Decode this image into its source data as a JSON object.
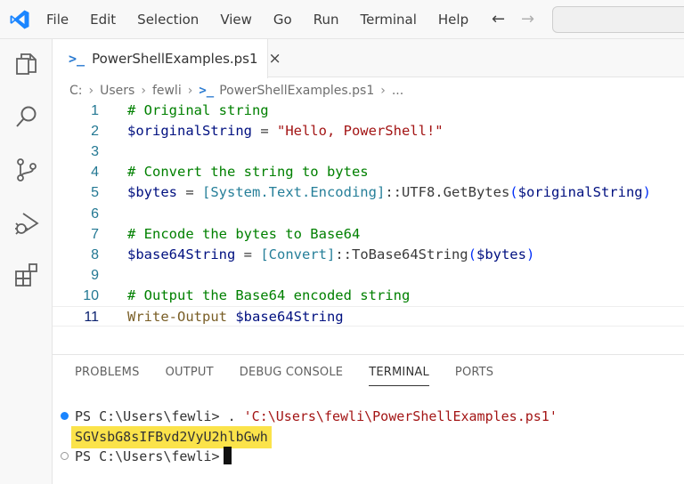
{
  "menu": {
    "items": [
      "File",
      "Edit",
      "Selection",
      "View",
      "Go",
      "Run",
      "Terminal",
      "Help"
    ]
  },
  "nav": {
    "back_icon": "arrow-left-icon",
    "forward_icon": "arrow-right-icon"
  },
  "activity_bar": {
    "icons": [
      "explorer-icon",
      "search-icon",
      "source-control-icon",
      "run-debug-icon",
      "extensions-icon"
    ]
  },
  "tab": {
    "icon_glyph": ">_",
    "label": "PowerShellExamples.ps1",
    "close_glyph": "×"
  },
  "breadcrumb": {
    "segments": [
      "C:",
      "Users",
      "fewli",
      "PowerShellExamples.ps1",
      "..."
    ]
  },
  "editor": {
    "current_line": 11,
    "lines": [
      {
        "n": "1",
        "tokens": [
          {
            "t": "# Original string",
            "c": "cm"
          }
        ]
      },
      {
        "n": "2",
        "tokens": [
          {
            "t": "$originalString",
            "c": "var"
          },
          {
            "t": " = ",
            "c": "op"
          },
          {
            "t": "\"Hello, PowerShell!\"",
            "c": "str"
          }
        ]
      },
      {
        "n": "3",
        "tokens": []
      },
      {
        "n": "4",
        "tokens": [
          {
            "t": "# Convert the string to bytes",
            "c": "cm"
          }
        ]
      },
      {
        "n": "5",
        "tokens": [
          {
            "t": "$bytes",
            "c": "var"
          },
          {
            "t": " = ",
            "c": "op"
          },
          {
            "t": "[System.Text.Encoding]",
            "c": "typ"
          },
          {
            "t": "::UTF8.GetBytes",
            "c": "mem"
          },
          {
            "t": "(",
            "c": "par"
          },
          {
            "t": "$originalString",
            "c": "var"
          },
          {
            "t": ")",
            "c": "par"
          }
        ]
      },
      {
        "n": "6",
        "tokens": []
      },
      {
        "n": "7",
        "tokens": [
          {
            "t": "# Encode the bytes to Base64",
            "c": "cm"
          }
        ]
      },
      {
        "n": "8",
        "tokens": [
          {
            "t": "$base64String",
            "c": "var"
          },
          {
            "t": " = ",
            "c": "op"
          },
          {
            "t": "[Convert]",
            "c": "typ"
          },
          {
            "t": "::ToBase64String",
            "c": "mem"
          },
          {
            "t": "(",
            "c": "par"
          },
          {
            "t": "$bytes",
            "c": "var"
          },
          {
            "t": ")",
            "c": "par"
          }
        ]
      },
      {
        "n": "9",
        "tokens": []
      },
      {
        "n": "10",
        "tokens": [
          {
            "t": "# Output the Base64 encoded string",
            "c": "cm"
          }
        ]
      },
      {
        "n": "11",
        "tokens": [
          {
            "t": "Write-Output",
            "c": "kw"
          },
          {
            "t": " ",
            "c": "op"
          },
          {
            "t": "$base64String",
            "c": "var"
          }
        ]
      }
    ]
  },
  "panel": {
    "tabs": [
      "PROBLEMS",
      "OUTPUT",
      "DEBUG CONSOLE",
      "TERMINAL",
      "PORTS"
    ],
    "active_tab": "TERMINAL"
  },
  "terminal": {
    "line1_prompt": "PS C:\\Users\\fewli> . ",
    "line1_arg": "'C:\\Users\\fewli\\PowerShellExamples.ps1'",
    "output": "SGVsbG8sIFBvd2VyU2hlbGwh",
    "line3_prompt": "PS C:\\Users\\fewli>"
  },
  "colors": {
    "accent": "#1a85ff",
    "highlight": "#fbe34a",
    "comment": "#008000",
    "variable": "#001080",
    "string": "#a31515",
    "type": "#267f99"
  }
}
